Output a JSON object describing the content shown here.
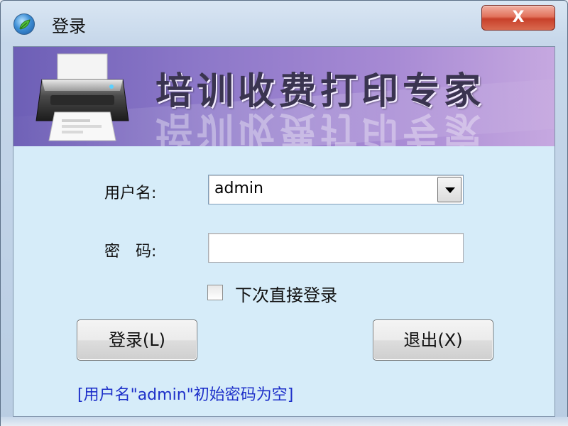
{
  "window": {
    "title": "登录",
    "close_label": "X",
    "colors": {
      "banner_start": "#6d5fb6",
      "banner_end": "#c6a8e0",
      "hint_text": "#1d2fc9",
      "client_bg": "#d6ecf9"
    }
  },
  "banner": {
    "title": "培训收费打印专家"
  },
  "icons": {
    "app_icon": "green-leaf-globe-icon",
    "banner_icon": "printer-icon",
    "close_icon": "close-icon",
    "dropdown_icon": "chevron-down-icon"
  },
  "form": {
    "username_label": "用户名:",
    "username_value": "admin",
    "password_label": "密　码:",
    "password_value": "",
    "remember_label": "下次直接登录",
    "remember_checked": false
  },
  "buttons": {
    "login": "登录(L)",
    "exit": "退出(X)"
  },
  "hint": "[用户名\"admin\"初始密码为空]"
}
